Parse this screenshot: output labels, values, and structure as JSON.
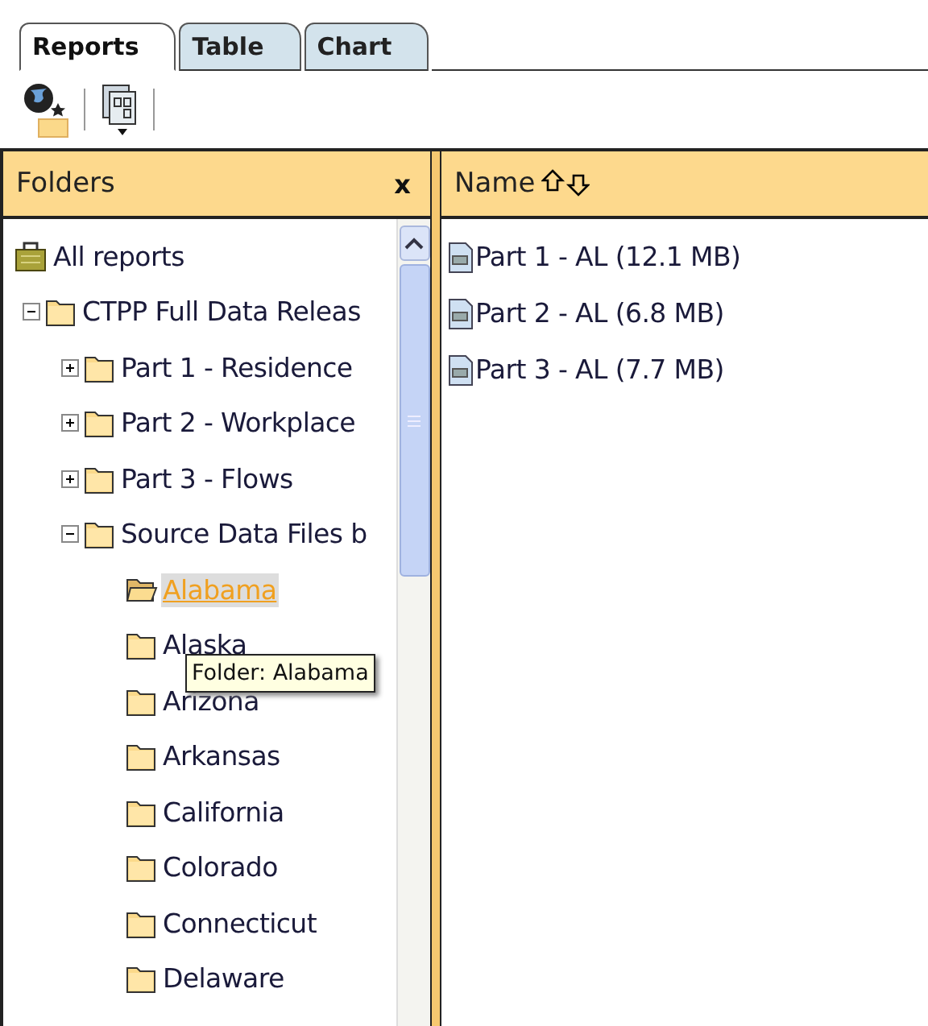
{
  "tabs": [
    {
      "label": "Reports",
      "selected": true
    },
    {
      "label": "Table",
      "selected": false
    },
    {
      "label": "Chart",
      "selected": false
    }
  ],
  "folders_pane": {
    "title": "Folders",
    "close": "x",
    "tree": [
      {
        "label": "All reports",
        "kind": "root",
        "children": [
          {
            "label": "CTPP Full Data Releas",
            "kind": "folder",
            "expanded": true,
            "children": [
              {
                "label": "Part 1 - Residence",
                "kind": "folder",
                "expanded": false
              },
              {
                "label": "Part 2 - Workplace",
                "kind": "folder",
                "expanded": false
              },
              {
                "label": "Part 3 - Flows",
                "kind": "folder",
                "expanded": false
              },
              {
                "label": "Source Data Files b",
                "kind": "folder",
                "expanded": true,
                "children": [
                  {
                    "label": "Alabama",
                    "kind": "leaf",
                    "selected": true
                  },
                  {
                    "label": "Alaska",
                    "kind": "leaf",
                    "selected": false
                  },
                  {
                    "label": "Arizona",
                    "kind": "leaf",
                    "selected": false
                  },
                  {
                    "label": "Arkansas",
                    "kind": "leaf",
                    "selected": false
                  },
                  {
                    "label": "California",
                    "kind": "leaf",
                    "selected": false
                  },
                  {
                    "label": "Colorado",
                    "kind": "leaf",
                    "selected": false
                  },
                  {
                    "label": "Connecticut",
                    "kind": "leaf",
                    "selected": false
                  },
                  {
                    "label": "Delaware",
                    "kind": "leaf",
                    "selected": false
                  }
                ]
              }
            ]
          }
        ]
      }
    ],
    "tooltip": "Folder: Alabama"
  },
  "files_pane": {
    "column": "Name",
    "files": [
      "Part 1 - AL (12.1 MB)",
      "Part 2 - AL (6.8 MB)",
      "Part 3 - AL (7.7 MB)"
    ]
  }
}
